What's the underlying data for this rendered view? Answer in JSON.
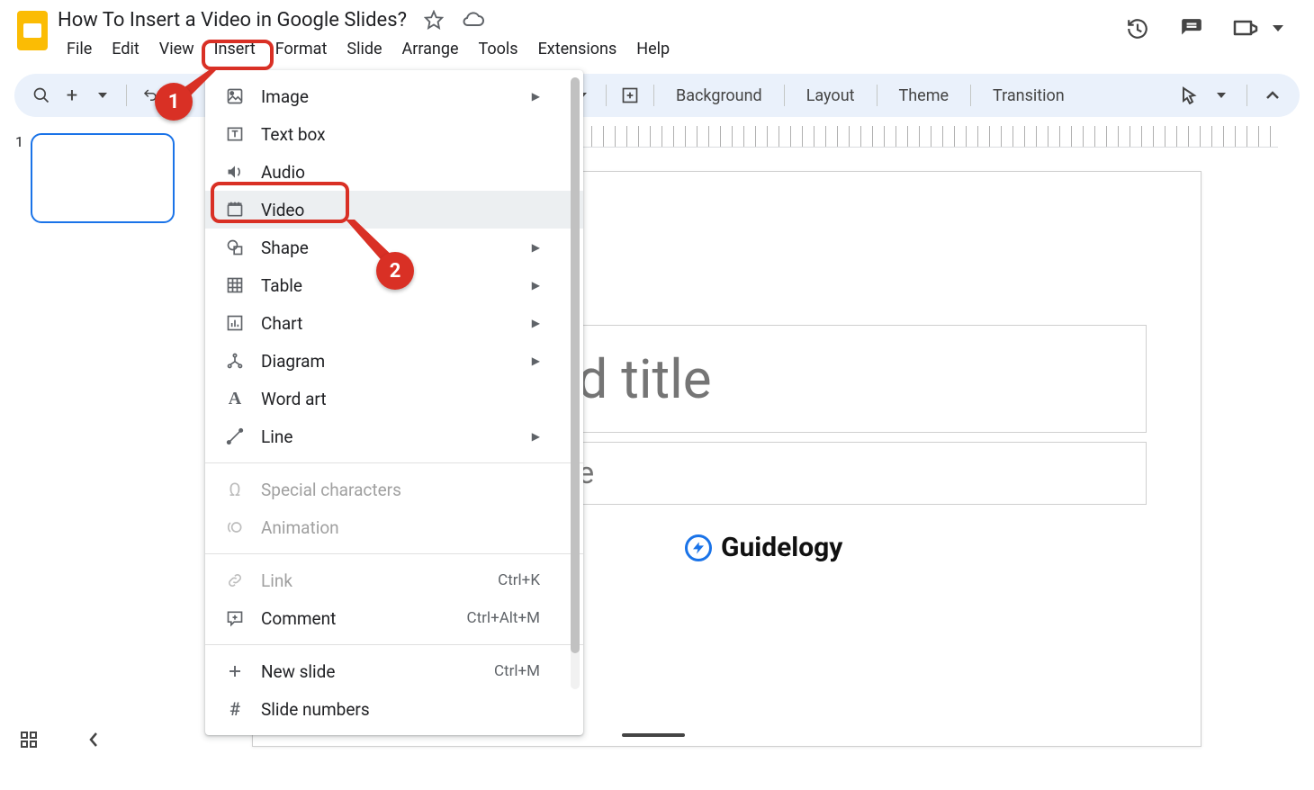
{
  "doc_title": "How To Insert a Video in Google Slides?",
  "menus": {
    "file": "File",
    "edit": "Edit",
    "view": "View",
    "insert": "Insert",
    "format": "Format",
    "slide": "Slide",
    "arrange": "Arrange",
    "tools": "Tools",
    "extensions": "Extensions",
    "help": "Help"
  },
  "toolbar": {
    "background": "Background",
    "layout": "Layout",
    "theme": "Theme",
    "transition": "Transition"
  },
  "thumb": {
    "number": "1"
  },
  "slide": {
    "title_placeholder": "Click to add title",
    "subtitle_placeholder": "Click to add subtitle",
    "watermark": "Guidelogy"
  },
  "dropdown": {
    "image": "Image",
    "textbox": "Text box",
    "audio": "Audio",
    "video": "Video",
    "shape": "Shape",
    "table": "Table",
    "chart": "Chart",
    "diagram": "Diagram",
    "wordart": "Word art",
    "line": "Line",
    "special": "Special characters",
    "animation": "Animation",
    "link": "Link",
    "link_shortcut": "Ctrl+K",
    "comment": "Comment",
    "comment_shortcut": "Ctrl+Alt+M",
    "newslide": "New slide",
    "newslide_shortcut": "Ctrl+M",
    "slidenumbers": "Slide numbers"
  },
  "callouts": {
    "one": "1",
    "two": "2"
  }
}
